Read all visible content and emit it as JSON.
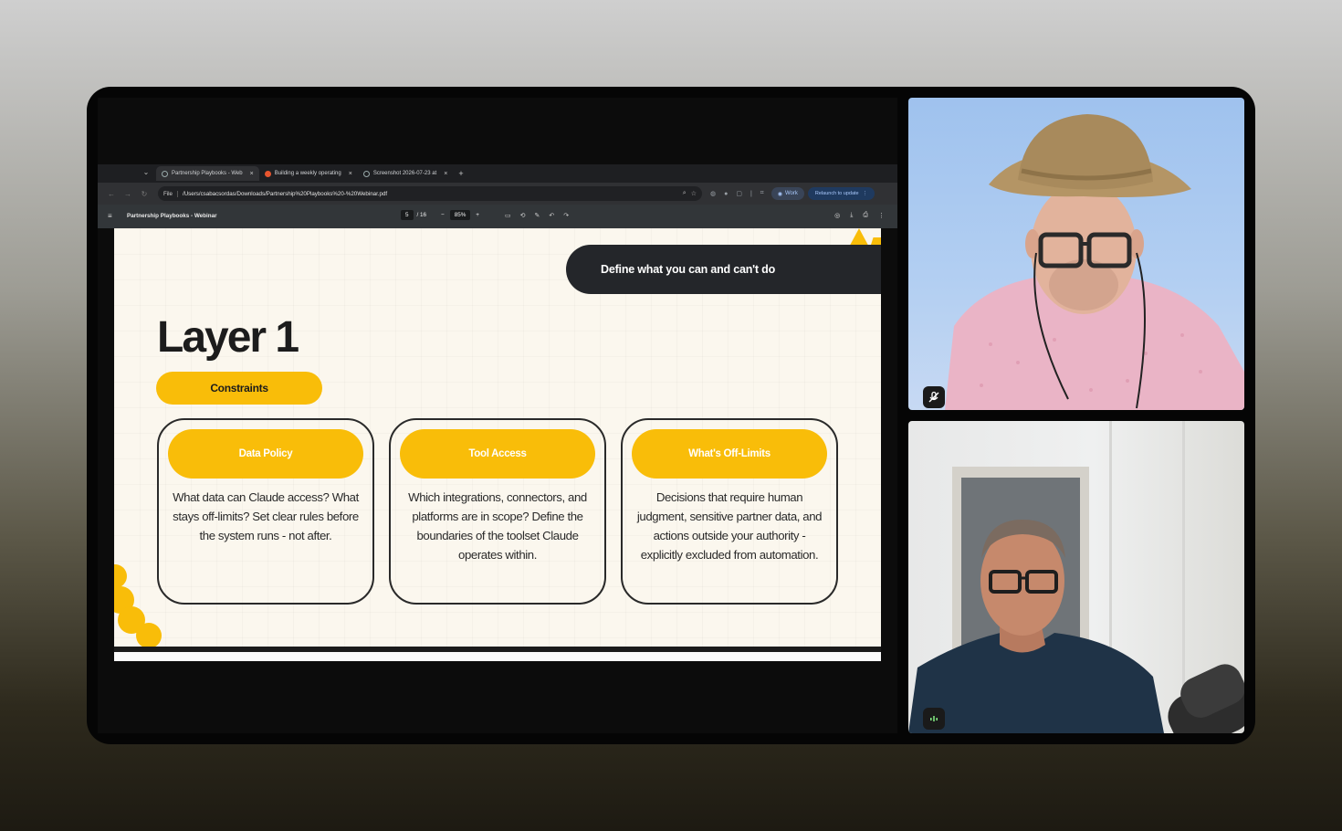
{
  "browser": {
    "tabs": [
      {
        "label": "Partnership Playbooks - Web"
      },
      {
        "label": "Building a weekly operating"
      },
      {
        "label": "Screenshot 2026-07-23 at"
      }
    ],
    "address": {
      "chip": "File",
      "url": "/Users/csabacsordas/Downloads/Partnership%20Playbooks%20-%20Webinar.pdf"
    },
    "profile_label": "Work",
    "relaunch_label": "Relaunch to update"
  },
  "pdf": {
    "title": "Partnership Playbooks - Webinar",
    "current_page": "5",
    "total_pages": "/ 16",
    "zoom": "85%"
  },
  "slide": {
    "tagline": "Define what you can and can't do",
    "title": "Layer 1",
    "badge": "Constraints",
    "cards": [
      {
        "title": "Data Policy",
        "body": "What data can Claude access? What stays off-limits? Set clear rules before the system runs - not after."
      },
      {
        "title": "Tool Access",
        "body": "Which integrations, connectors, and platforms are in scope? Define the boundaries of the toolset Claude operates within."
      },
      {
        "title": "What's Off-Limits",
        "body": "Decisions that require human judgment, sensitive partner data, and actions outside your authority - explicitly excluded from automation."
      }
    ]
  },
  "colors": {
    "accent": "#f9bd09",
    "dark": "#24262a",
    "slide_bg": "#fbf7ee"
  },
  "participants": [
    {
      "status_icon": "mic-muted-icon"
    },
    {
      "status_icon": "speaking-indicator-icon"
    }
  ]
}
